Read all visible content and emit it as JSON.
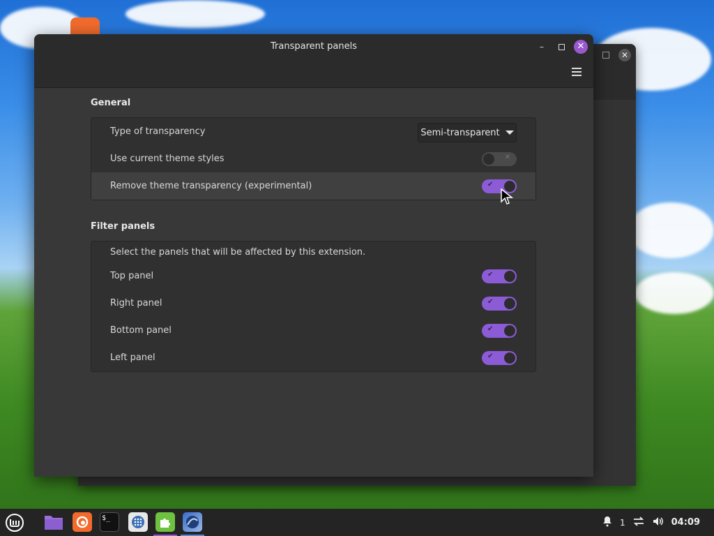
{
  "window": {
    "title": "Transparent panels",
    "minimize_glyph": "–",
    "close_glyph": "✕"
  },
  "general": {
    "heading": "General",
    "type_of_transparency": {
      "label": "Type of transparency",
      "value": "Semi-transparent"
    },
    "use_theme_styles": {
      "label": "Use current theme styles",
      "enabled": false
    },
    "remove_theme_transparency": {
      "label": "Remove theme transparency (experimental)",
      "enabled": true
    }
  },
  "filter": {
    "heading": "Filter panels",
    "description": "Select the panels that will be affected by this extension.",
    "panels": [
      {
        "label": "Top panel",
        "enabled": true
      },
      {
        "label": "Right panel",
        "enabled": true
      },
      {
        "label": "Bottom panel",
        "enabled": true
      },
      {
        "label": "Left panel",
        "enabled": true
      }
    ]
  },
  "taskbar": {
    "apps": [
      "menu-icon",
      "files-icon",
      "firefox-icon",
      "terminal-icon",
      "app-grid-icon",
      "extensions-icon",
      "xp-theme-icon"
    ],
    "notifications_count": "1",
    "clock": "04:09"
  },
  "colors": {
    "accent": "#8c5bd6",
    "window_bg": "#383838",
    "titlebar_bg": "#2b2b2b",
    "taskbar_bg": "#242424"
  }
}
